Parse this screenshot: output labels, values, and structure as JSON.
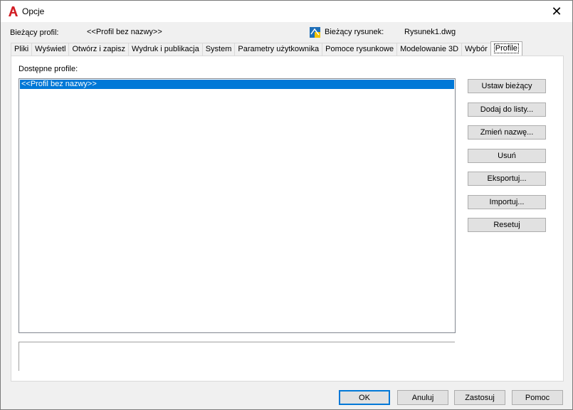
{
  "window": {
    "title": "Opcje",
    "close_glyph": "✕"
  },
  "header": {
    "current_profile_label": "Bieżący profil:",
    "current_profile_value": "<<Profil bez nazwy>>",
    "current_drawing_label": "Bieżący rysunek:",
    "current_drawing_value": "Rysunek1.dwg"
  },
  "tabs": [
    {
      "label": "Pliki"
    },
    {
      "label": "Wyświetl"
    },
    {
      "label": "Otwórz i zapisz"
    },
    {
      "label": "Wydruk i publikacja"
    },
    {
      "label": "System"
    },
    {
      "label": "Parametry użytkownika"
    },
    {
      "label": "Pomoce rysunkowe"
    },
    {
      "label": "Modelowanie 3D"
    },
    {
      "label": "Wybór"
    },
    {
      "label": "Profile"
    }
  ],
  "active_tab": "Profile",
  "profiles": {
    "label": "Dostępne profile:",
    "items": [
      "<<Profil bez nazwy>>"
    ]
  },
  "buttons": {
    "set_current": "Ustaw bieżący",
    "add_to_list": "Dodaj do listy...",
    "rename": "Zmień nazwę...",
    "delete": "Usuń",
    "export": "Eksportuj...",
    "import": "Importuj...",
    "reset": "Resetuj"
  },
  "footer": {
    "ok": "OK",
    "cancel": "Anuluj",
    "apply": "Zastosuj",
    "help": "Pomoc"
  },
  "colors": {
    "selection": "#0078d7",
    "app_icon": "#d21f26"
  }
}
